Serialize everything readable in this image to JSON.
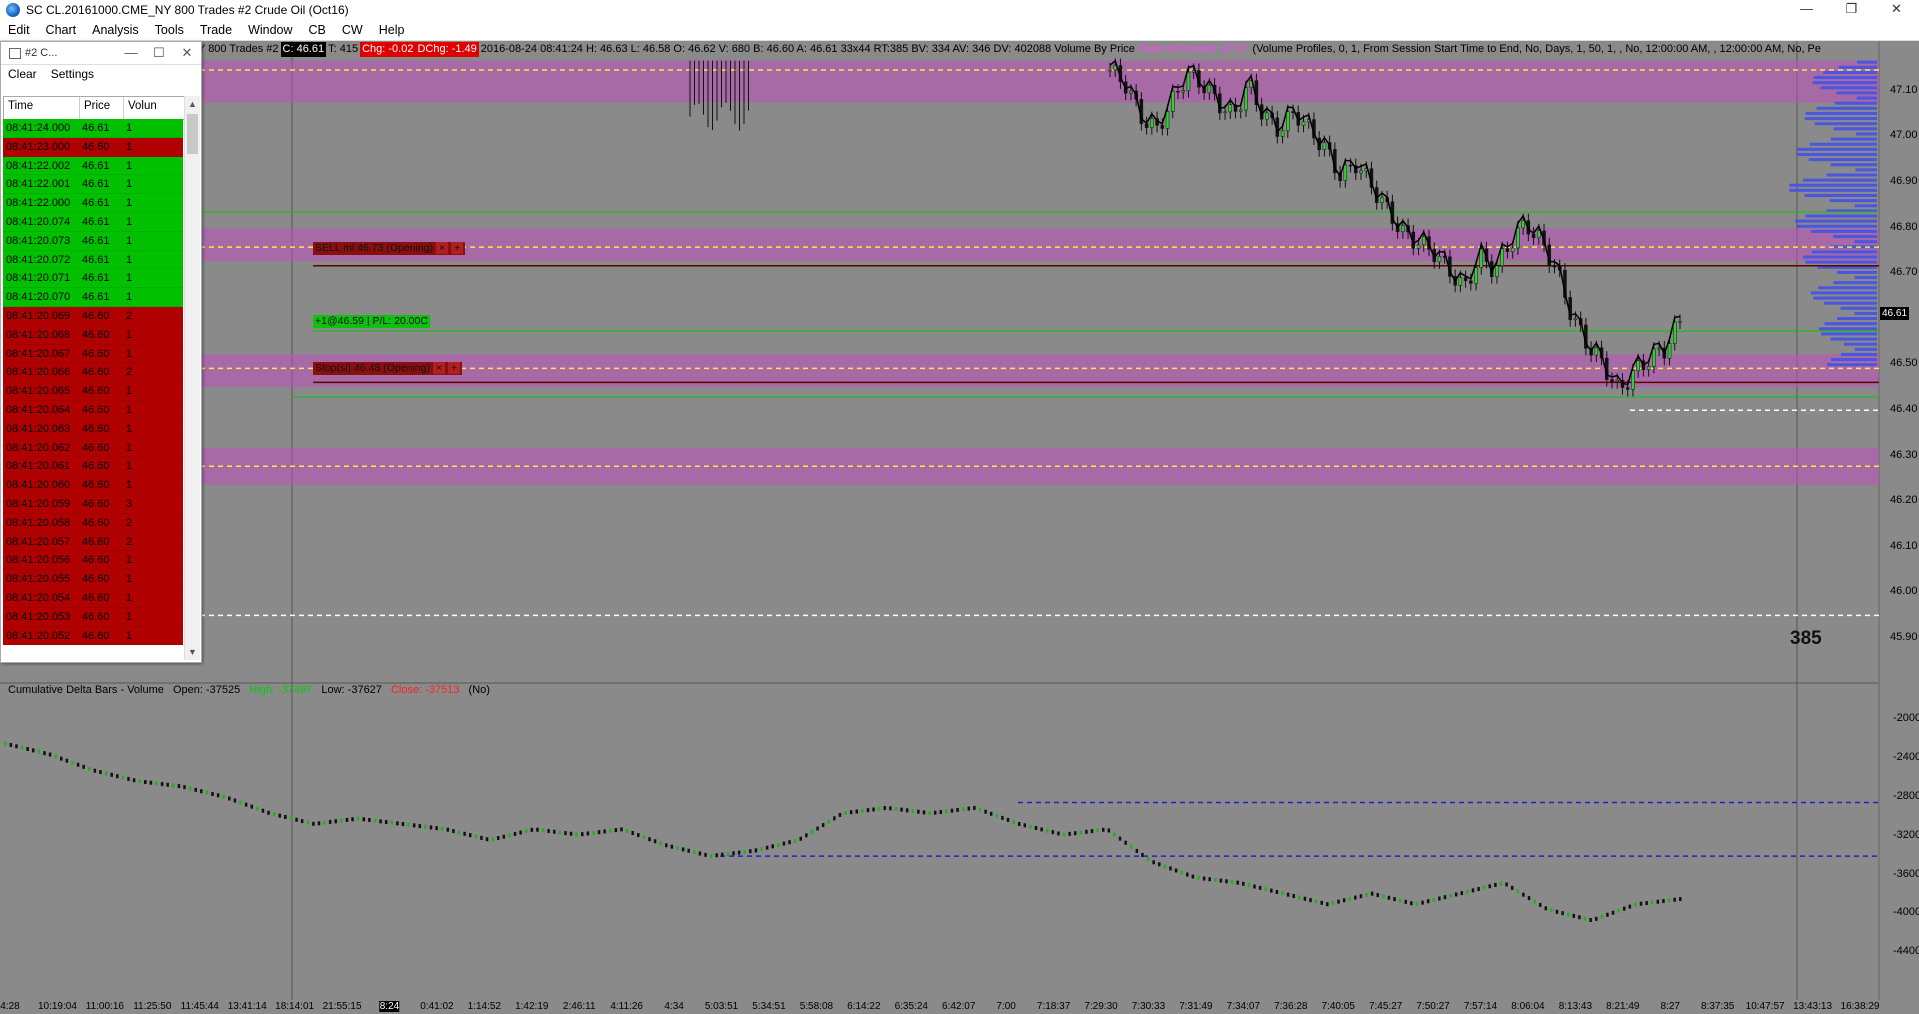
{
  "window": {
    "title": "SC CL.20161000.CME_NY  800 Trades  #2  Crude Oil (Oct16)",
    "controls": [
      "—",
      "❐",
      "✕"
    ]
  },
  "menu": [
    "Edit",
    "Chart",
    "Analysis",
    "Tools",
    "Trade",
    "Window",
    "CB",
    "CW",
    "Help"
  ],
  "infobar": {
    "prefix": "Y  800 Trades  #2",
    "close": "C: 46.61",
    "trades": "T: 415",
    "chg": "Chg: -0.02",
    "dchg": "DChg: -1.49",
    "details": "2016-08-24 08:41:24 H: 46.63  L: 46.58  O: 46.62  V: 680  B: 46.60  A: 46.61  33x44  RT:385  BV: 334  AV: 346  DV: 402088  Volume By Price",
    "poc": "Point of Control: 47.57",
    "profile": "(Volume Profiles, 0, 1, From Session Start Time to End, No, Days, 1, 50, 1, , No, 12:00:00 AM, , 12:00:00 AM, No, Pe"
  },
  "time_sales": {
    "title": "#2 C...",
    "menu": [
      "Clear",
      "Settings"
    ],
    "columns": [
      "Time",
      "Price",
      "Volun"
    ],
    "rows": [
      {
        "time": "08:41:24.000",
        "price": "46.61",
        "vol": "1",
        "side": "green"
      },
      {
        "time": "08:41:23.000",
        "price": "46.60",
        "vol": "1",
        "side": "red"
      },
      {
        "time": "08:41:22.002",
        "price": "46.61",
        "vol": "1",
        "side": "green"
      },
      {
        "time": "08:41:22.001",
        "price": "46.61",
        "vol": "1",
        "side": "green"
      },
      {
        "time": "08:41:22.000",
        "price": "46.61",
        "vol": "1",
        "side": "green"
      },
      {
        "time": "08:41:20.074",
        "price": "46.61",
        "vol": "1",
        "side": "green"
      },
      {
        "time": "08:41:20.073",
        "price": "46.61",
        "vol": "1",
        "side": "green"
      },
      {
        "time": "08:41:20.072",
        "price": "46.61",
        "vol": "1",
        "side": "green"
      },
      {
        "time": "08:41:20.071",
        "price": "46.61",
        "vol": "1",
        "side": "green"
      },
      {
        "time": "08:41:20.070",
        "price": "46.61",
        "vol": "1",
        "side": "green"
      },
      {
        "time": "08:41:20.069",
        "price": "46.60",
        "vol": "2",
        "side": "red"
      },
      {
        "time": "08:41:20.068",
        "price": "46.60",
        "vol": "1",
        "side": "red"
      },
      {
        "time": "08:41:20.067",
        "price": "46.60",
        "vol": "1",
        "side": "red"
      },
      {
        "time": "08:41:20.066",
        "price": "46.60",
        "vol": "2",
        "side": "red"
      },
      {
        "time": "08:41:20.065",
        "price": "46.60",
        "vol": "1",
        "side": "red"
      },
      {
        "time": "08:41:20.064",
        "price": "46.60",
        "vol": "1",
        "side": "red"
      },
      {
        "time": "08:41:20.063",
        "price": "46.60",
        "vol": "1",
        "side": "red"
      },
      {
        "time": "08:41:20.062",
        "price": "46.60",
        "vol": "1",
        "side": "red"
      },
      {
        "time": "08:41:20.061",
        "price": "46.60",
        "vol": "1",
        "side": "red"
      },
      {
        "time": "08:41:20.060",
        "price": "46.60",
        "vol": "1",
        "side": "red"
      },
      {
        "time": "08:41:20.059",
        "price": "46.60",
        "vol": "3",
        "side": "red"
      },
      {
        "time": "08:41:20.058",
        "price": "46.60",
        "vol": "2",
        "side": "red"
      },
      {
        "time": "08:41:20.057",
        "price": "46.60",
        "vol": "2",
        "side": "red"
      },
      {
        "time": "08:41:20.056",
        "price": "46.60",
        "vol": "1",
        "side": "red"
      },
      {
        "time": "08:41:20.055",
        "price": "46.60",
        "vol": "1",
        "side": "red"
      },
      {
        "time": "08:41:20.054",
        "price": "46.60",
        "vol": "1",
        "side": "red"
      },
      {
        "time": "08:41:20.053",
        "price": "46.60",
        "vol": "1",
        "side": "red"
      },
      {
        "time": "08:41:20.052",
        "price": "46.60",
        "vol": "1",
        "side": "red"
      }
    ]
  },
  "orders": {
    "sell_stop": "SELL ml 46.73 (Opening)",
    "position": "+1@46.59 | P/L: 20.00C",
    "buy_stop": "Stop(sl) 46.48 (Opening)"
  },
  "price_axis": {
    "ticks": [
      "47.10",
      "47.00",
      "46.90",
      "46.80",
      "46.70",
      "46.61",
      "46.50",
      "46.40",
      "46.30",
      "46.20",
      "46.10",
      "46.00",
      "45.90"
    ]
  },
  "delta_axis": {
    "ticks": [
      "-20000",
      "-24000",
      "-28000",
      "-32000",
      "-36000",
      "-40000",
      "-44000"
    ]
  },
  "lower_panel": {
    "name": "Cumulative Delta Bars - Volume",
    "open": "Open: -37525",
    "high": "High: -37497",
    "low": "Low: -37627",
    "close": "Close: -37513",
    "flag": "(No)"
  },
  "bar_counter": "385",
  "x_ticks": [
    "4:28",
    "10:19:04",
    "11:00:16",
    "11:25:50",
    "11:45:44",
    "13:41:14",
    "18:14:01",
    "21:55:15",
    "8:24",
    "0:41:02",
    "1:14:52",
    "1:42:19",
    "2:46:11",
    "4:11:26",
    "4:34",
    "5:03:51",
    "5:34:51",
    "5:58:08",
    "6:14:22",
    "6:35:24",
    "6:42:07",
    "7:00",
    "7:18:37",
    "7:29:30",
    "7:30:33",
    "7:31:49",
    "7:34:07",
    "7:36:28",
    "7:40:05",
    "7:45:27",
    "7:50:27",
    "7:57:14",
    "8:06:04",
    "8:13:43",
    "8:21:49",
    "8:27",
    "8:37:35",
    "10:47:57",
    "13:43:13",
    "16:38:29"
  ],
  "chart_data": [
    {
      "type": "candlestick",
      "title": "",
      "ylabel": "",
      "ylim": [
        45.85,
        47.18
      ],
      "grid": false,
      "levels": {
        "position_entry": 46.59,
        "sell_order": 46.73,
        "stop_order": 46.48,
        "dashed_yellow": [
          47.15,
          46.77,
          46.51,
          46.3
        ],
        "dashed_white": [
          46.42,
          45.98
        ],
        "magenta_zones": [
          [
            47.08,
            47.17
          ],
          [
            46.74,
            46.81
          ],
          [
            46.47,
            46.54
          ],
          [
            46.26,
            46.34
          ]
        ]
      },
      "close_path": [
        47.15,
        47.12,
        47.05,
        47.02,
        47.08,
        47.14,
        47.12,
        47.08,
        47.05,
        47.12,
        47.05,
        47.02,
        47.06,
        47.02,
        46.98,
        46.92,
        46.95,
        46.9,
        46.85,
        46.8,
        46.78,
        46.76,
        46.72,
        46.68,
        46.75,
        46.72,
        46.78,
        46.82,
        46.78,
        46.72,
        46.62,
        46.56,
        46.52,
        46.46,
        46.5,
        46.53,
        46.55,
        46.61
      ]
    },
    {
      "type": "bar",
      "title": "Cumulative Delta Bars - Volume",
      "ylim": [
        -46000,
        -18000
      ],
      "levels": {
        "dashed_blue": [
          -28500,
          -33500
        ]
      },
      "values": [
        -23000,
        -24000,
        -25500,
        -26500,
        -27000,
        -28000,
        -29500,
        -30500,
        -30000,
        -30500,
        -31000,
        -32000,
        -31000,
        -31500,
        -31000,
        -32500,
        -33500,
        -33000,
        -32000,
        -29500,
        -29000,
        -29500,
        -29000,
        -30500,
        -31500,
        -31000,
        -34000,
        -35500,
        -36000,
        -37000,
        -38000,
        -37000,
        -38000,
        -37000,
        -36000,
        -38500,
        -39500,
        -38000,
        -37513
      ]
    }
  ],
  "colors": {
    "chart_bg": "#8a8a8a",
    "bid_row": "#b00000",
    "ask_row": "#00c000",
    "zone": "#c050c0",
    "profile": "#4a55e0"
  }
}
